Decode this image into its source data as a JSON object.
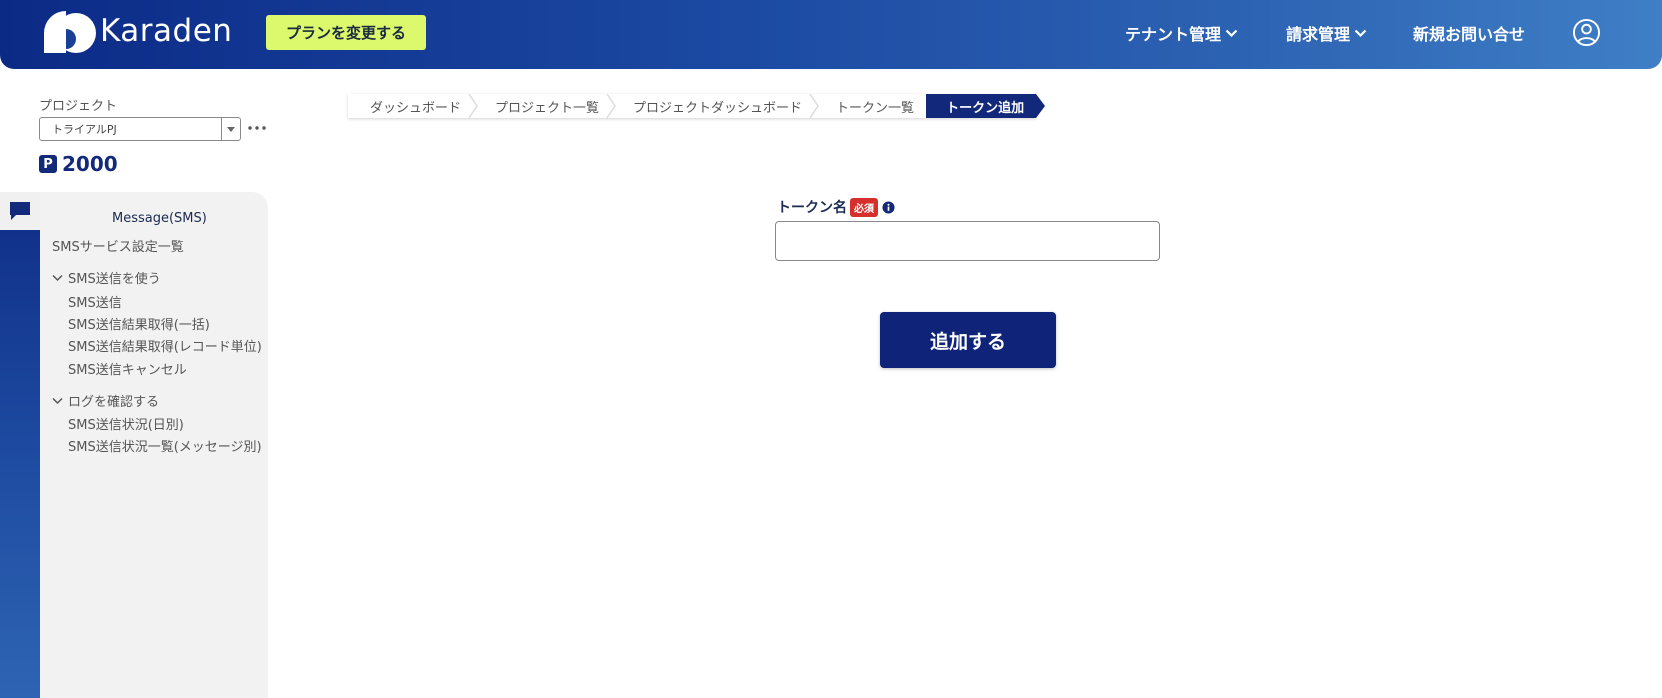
{
  "header": {
    "logo_text": "Karaden",
    "plan_button": "プランを変更する",
    "nav": [
      {
        "label": "テナント管理",
        "dropdown": true
      },
      {
        "label": "請求管理",
        "dropdown": true
      },
      {
        "label": "新規お問い合せ",
        "dropdown": false
      }
    ],
    "user_icon": "user-circle-icon"
  },
  "sidebar": {
    "project_label": "プロジェクト",
    "project_selected": "トライアルPJ",
    "points_badge": "P",
    "points_value": "2000",
    "section_icon": "chat-bubble-icon",
    "section_title": "Message(SMS)",
    "top_item": "SMSサービス設定一覧",
    "groups": [
      {
        "label": "SMS送信を使う",
        "items": [
          "SMS送信",
          "SMS送信結果取得(一括)",
          "SMS送信結果取得(レコード単位)",
          "SMS送信キャンセル"
        ]
      },
      {
        "label": "ログを確認する",
        "items": [
          "SMS送信状況(日別)",
          "SMS送信状況一覧(メッセージ別)"
        ]
      }
    ]
  },
  "breadcrumb": {
    "items": [
      "ダッシュボード",
      "プロジェクト一覧",
      "プロジェクトダッシュボード",
      "トークン一覧"
    ],
    "current": "トークン追加"
  },
  "form": {
    "label": "トークン名",
    "required_badge": "必須",
    "input_value": "",
    "submit_label": "追加する"
  },
  "colors": {
    "header_gradient_start": "#0b2a86",
    "header_gradient_end": "#3f7fc6",
    "plan_button_bg": "#dcf86c",
    "primary_navy": "#12287a",
    "required_red": "#d6302e",
    "sidebar_bg": "#f2f2f2"
  }
}
